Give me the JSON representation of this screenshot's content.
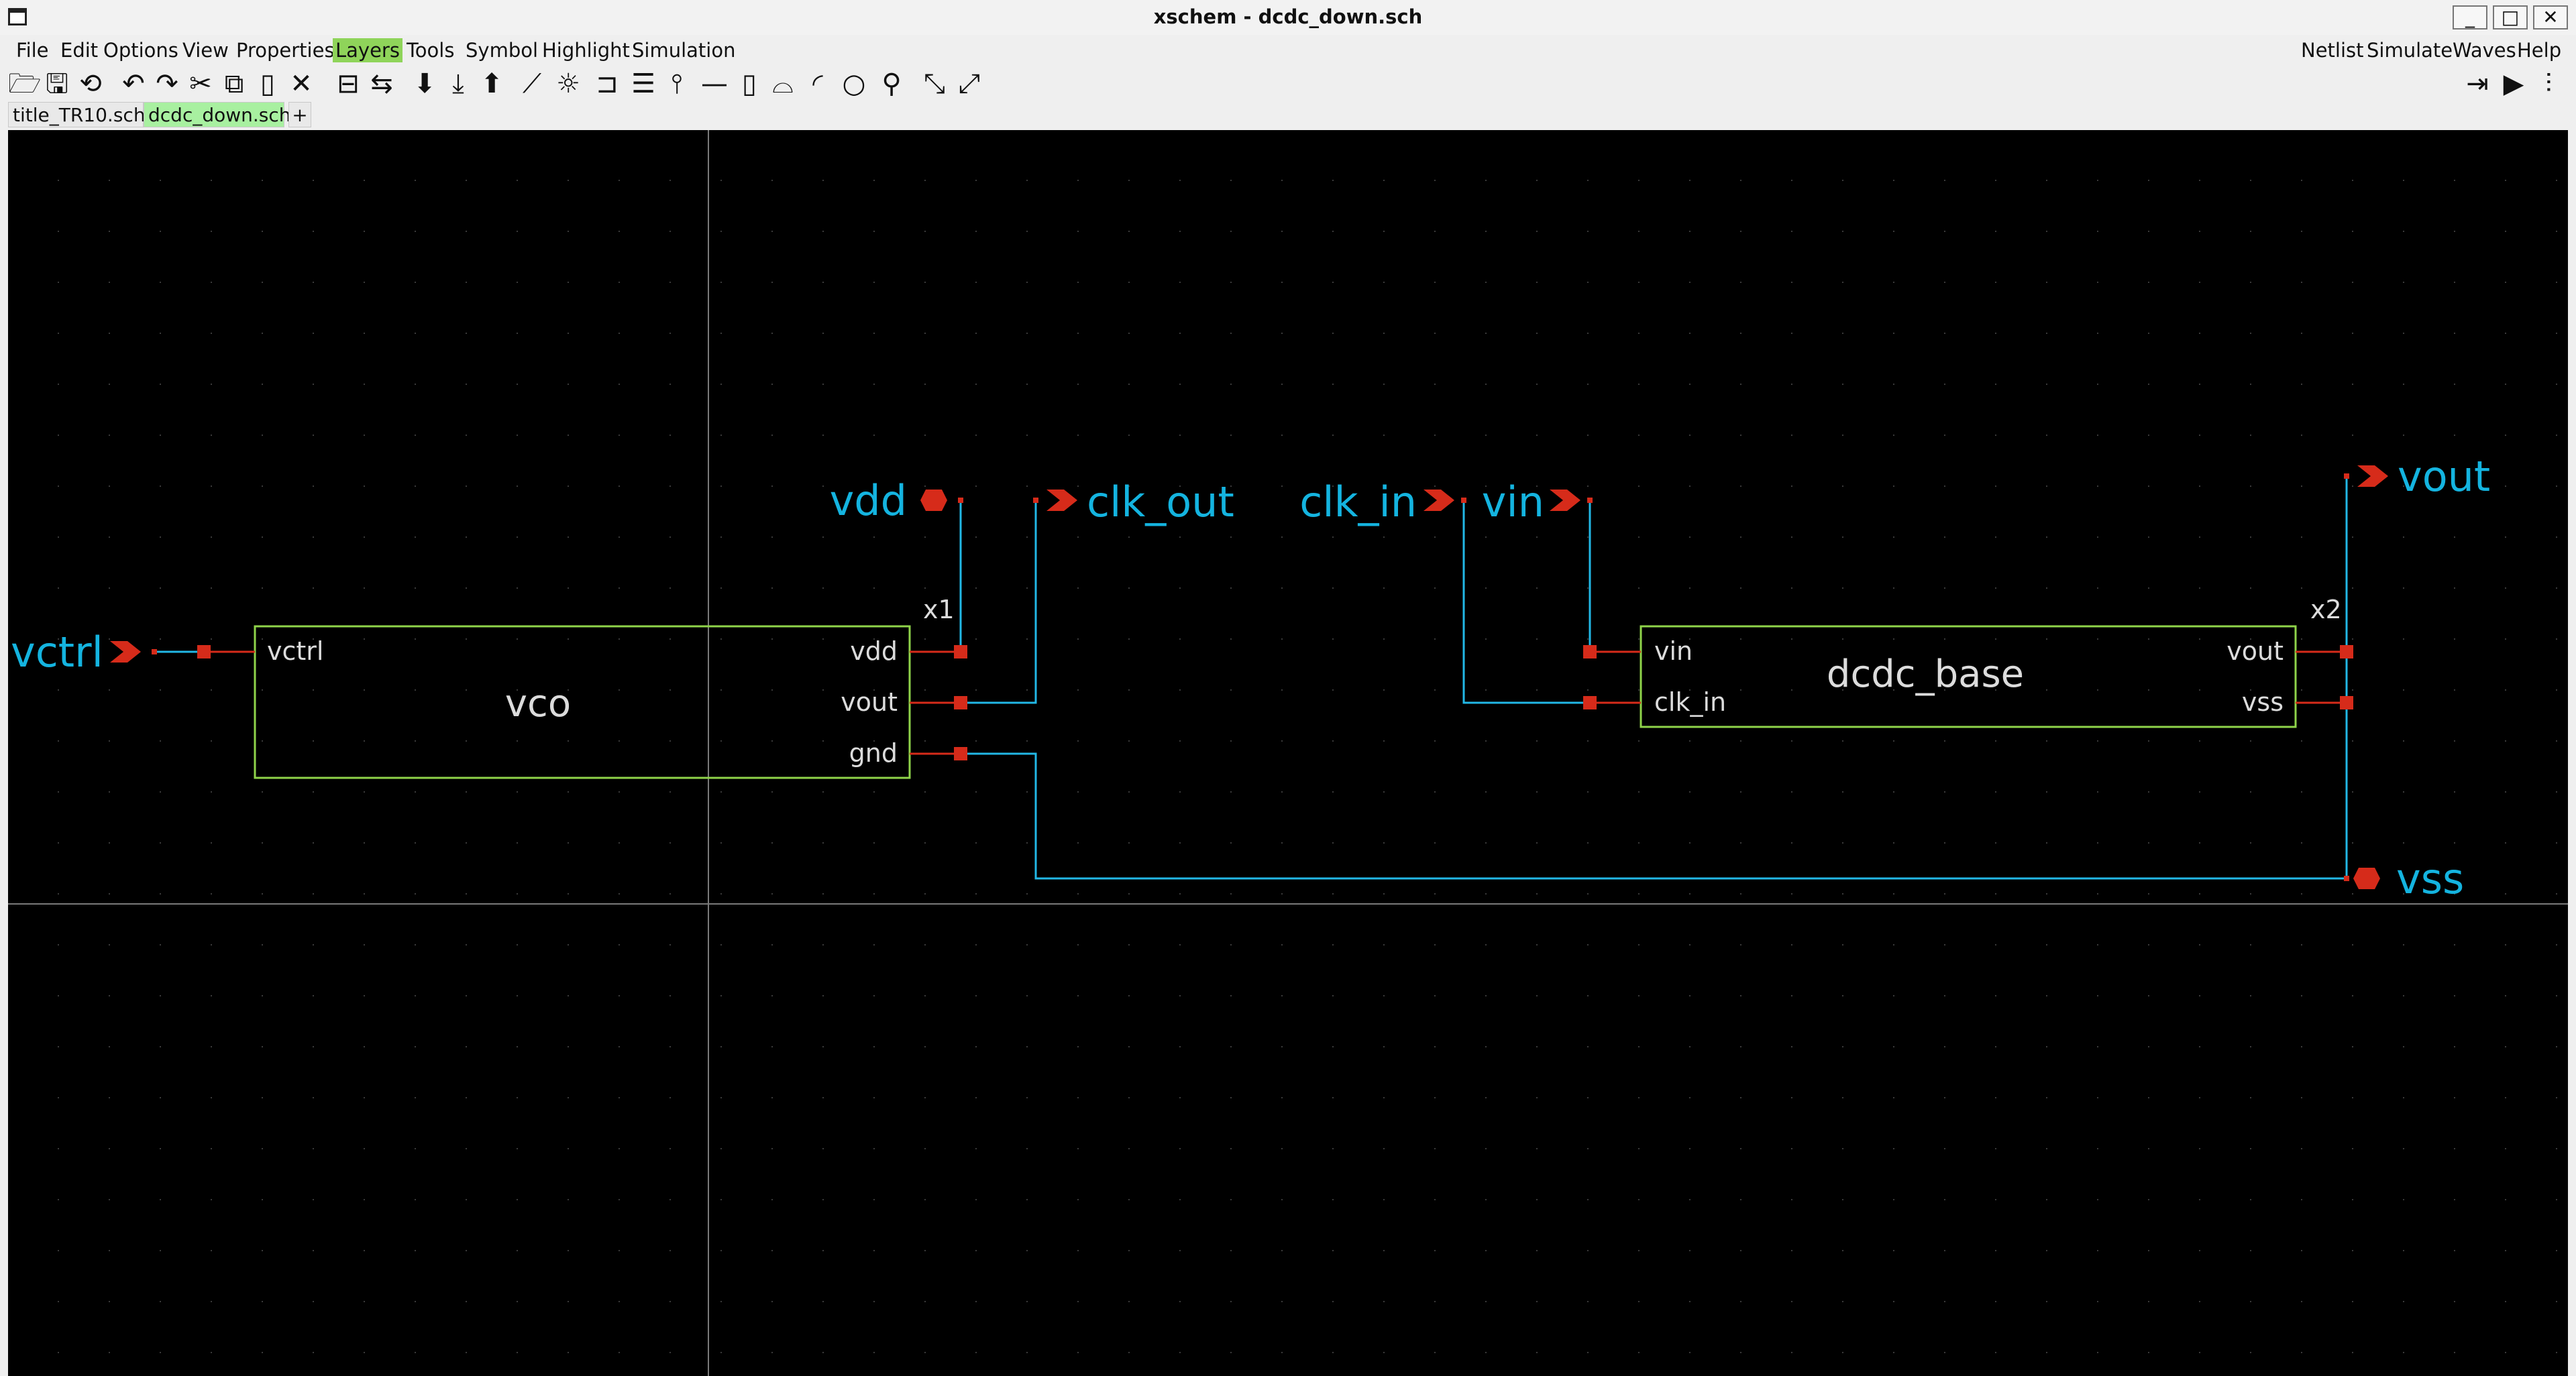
{
  "window": {
    "title": "xschem - dcdc_down.sch",
    "minimize_glyph": "_",
    "maximize_glyph": "□",
    "close_glyph": "✕"
  },
  "menubar": {
    "left": [
      "File",
      "Edit",
      "Options",
      "View",
      "Properties",
      "Layers",
      "Tools",
      "Symbol",
      "Highlight",
      "Simulation"
    ],
    "active": "Layers",
    "right": [
      "Netlist",
      "Simulate",
      "Waves",
      "Help"
    ]
  },
  "toolbar": {
    "left_icons": [
      "open-icon",
      "save-icon",
      "reload-icon",
      "undo-icon",
      "redo-icon",
      "cut-icon",
      "copy-icon",
      "paste-icon",
      "delete-icon",
      "place-symbol-icon",
      "move-icon",
      "descend-icon",
      "descend-symbol-icon",
      "go-back-icon",
      "wire-icon",
      "highlight-icon",
      "net-label-icon",
      "text-icon",
      "pin-icon",
      "line-icon",
      "rectangle-icon",
      "polygon-icon",
      "arc-icon",
      "circle-icon",
      "zoom-icon",
      "zoom-out-icon",
      "zoom-full-icon"
    ],
    "right_icons": [
      "netlist-icon",
      "simulate-icon",
      "waves-icon"
    ]
  },
  "tabs": {
    "items": [
      "title_TR10.sch",
      "dcdc_down.sch"
    ],
    "active": "dcdc_down.sch",
    "add_label": "+"
  },
  "schematic": {
    "colors": {
      "background": "#000000",
      "wire": "#22b8e6",
      "pin": "#d62b1a",
      "box": "#8fd44a",
      "symbol_text": "#dcdcdc",
      "label_text": "#14b4e0",
      "grid": "#3a3a3a"
    },
    "symbols": [
      {
        "instance": "x1",
        "name": "vco",
        "pins_left": [
          "vctrl"
        ],
        "pins_right": [
          "vdd",
          "vout",
          "gnd"
        ]
      },
      {
        "instance": "x2",
        "name": "dcdc_base",
        "pins_left": [
          "vin",
          "clk_in"
        ],
        "pins_right": [
          "vout",
          "vss"
        ]
      }
    ],
    "net_labels": {
      "vctrl": "vctrl",
      "vdd": "vdd",
      "clk_out": "clk_out",
      "clk_in": "clk_in",
      "vin": "vin",
      "vout": "vout",
      "vss": "vss"
    }
  }
}
